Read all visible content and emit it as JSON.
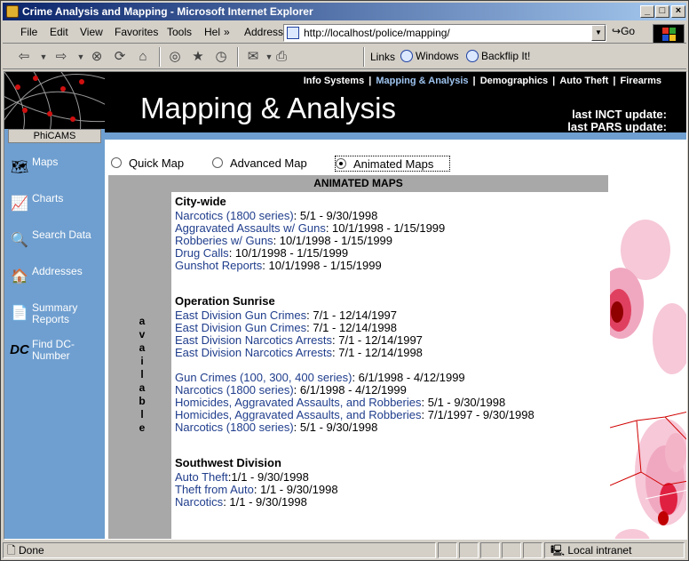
{
  "window": {
    "title": "Crime Analysis and Mapping - Microsoft Internet Explorer"
  },
  "menu": {
    "items": [
      "File",
      "Edit",
      "View",
      "Favorites",
      "Tools",
      "Hel"
    ],
    "more": "»",
    "address_label": "Address",
    "url": "http://localhost/police/mapping/",
    "go_label": "Go"
  },
  "links_bar": {
    "label": "Links",
    "items": [
      "Windows",
      "Backflip It!"
    ]
  },
  "sidebar": {
    "brand": "PhiCAMS",
    "items": [
      {
        "label": "Maps",
        "icon": "map-icon"
      },
      {
        "label": "Charts",
        "icon": "chart-icon"
      },
      {
        "label": "Search Data",
        "icon": "magnifier-icon"
      },
      {
        "label": "Addresses",
        "icon": "house-icon"
      },
      {
        "label": "Summary Reports",
        "icon": "report-icon"
      },
      {
        "label": "Find DC-Number",
        "icon": "dc-icon"
      }
    ]
  },
  "topnav": {
    "tabs": [
      "Info Systems",
      "Mapping & Analysis",
      "Demographics",
      "Auto Theft",
      "Firearms"
    ],
    "active_tab": "Mapping & Analysis",
    "heading": "Mapping & Analysis",
    "inct_update": "last INCT update:",
    "pars_update": "last PARS update:"
  },
  "radios": {
    "options": [
      "Quick Map",
      "Advanced Map",
      "Animated Maps"
    ],
    "selected": "Animated Maps"
  },
  "main": {
    "banner": "ANIMATED MAPS",
    "vertical_label": "available",
    "sections": [
      {
        "title": "City-wide",
        "rows": [
          {
            "link": "Narcotics (1800 series)",
            "range": ": 5/1 - 9/30/1998"
          },
          {
            "link": "Aggravated Assaults w/ Guns",
            "range": ": 10/1/1998 - 1/15/1999"
          },
          {
            "link": "Robberies w/ Guns",
            "range": ": 10/1/1998 - 1/15/1999"
          },
          {
            "link": "Drug Calls",
            "range": ": 10/1/1998 - 1/15/1999"
          },
          {
            "link": "Gunshot Reports",
            "range": ": 10/1/1998 - 1/15/1999"
          }
        ]
      },
      {
        "title": "Operation Sunrise",
        "rows": [
          {
            "link": "East Division Gun Crimes",
            "range": ": 7/1 - 12/14/1997"
          },
          {
            "link": "East Division Gun Crimes",
            "range": ": 7/1 - 12/14/1998"
          },
          {
            "link": "East Division Narcotics Arrests",
            "range": ": 7/1 - 12/14/1997"
          },
          {
            "link": "East Division Narcotics Arrests",
            "range": ": 7/1 - 12/14/1998"
          },
          {
            "link": "Gun Crimes (100, 300, 400 series)",
            "range": ": 6/1/1998 - 4/12/1999"
          },
          {
            "link": "Narcotics (1800 series)",
            "range": ": 6/1/1998 - 4/12/1999"
          },
          {
            "link": "Homicides, Aggravated Assaults, and Robberies",
            "range": ": 5/1 - 9/30/1998"
          },
          {
            "link": "Homicides, Aggravated Assaults, and Robberies",
            "range": ": 7/1/1997 - 9/30/1998"
          },
          {
            "link": "Narcotics (1800 series)",
            "range": ": 5/1 - 9/30/1998"
          }
        ]
      },
      {
        "title": "Southwest Division",
        "rows": [
          {
            "link": "Auto Theft",
            "range": ":1/1 - 9/30/1998"
          },
          {
            "link": "Theft from Auto",
            "range": ": 1/1 - 9/30/1998"
          },
          {
            "link": "Narcotics",
            "range": ": 1/1 - 9/30/1998"
          }
        ]
      }
    ]
  },
  "status": {
    "text": "Done",
    "zone": "Local intranet"
  },
  "colors": {
    "sidebar": "#6f9fd0",
    "link": "#1f3d8c",
    "header": "#000000"
  }
}
